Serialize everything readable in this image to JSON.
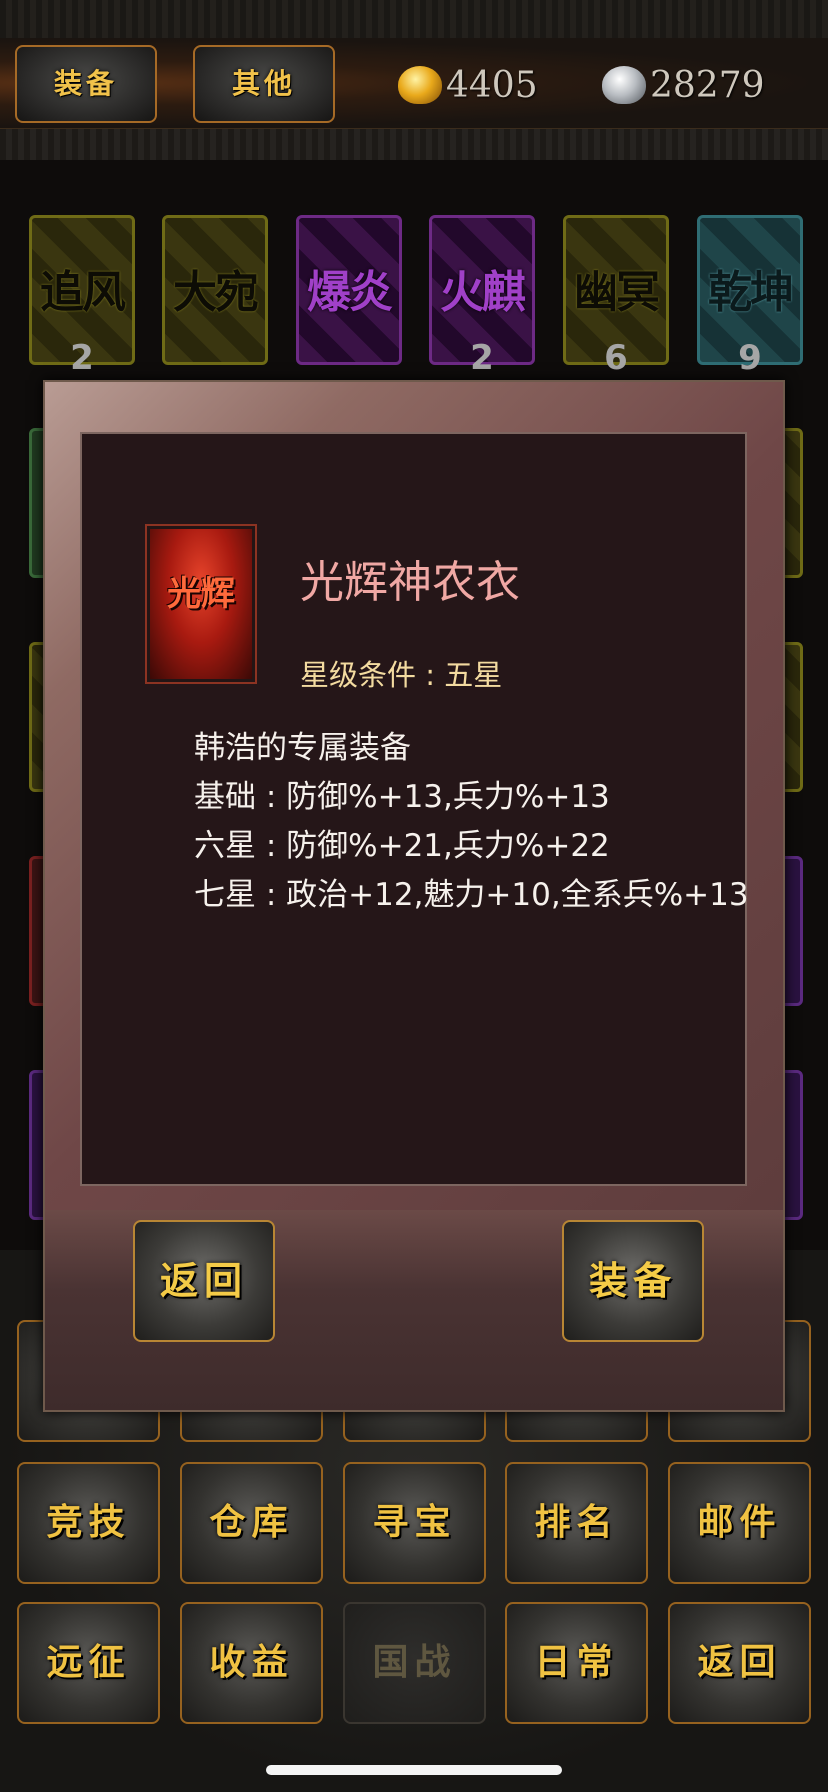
{
  "topbar": {
    "tab_equip": "装备",
    "tab_other": "其他",
    "gold": {
      "icon": "gold-ingot-icon",
      "amount": "4405"
    },
    "silver": {
      "icon": "silver-ingot-icon",
      "amount": "28279"
    }
  },
  "horses": [
    {
      "name": "追风",
      "count": "2",
      "quality": "yellow"
    },
    {
      "name": "大宛",
      "count": "",
      "quality": "yellow"
    },
    {
      "name": "爆炎",
      "count": "",
      "quality": "purple"
    },
    {
      "name": "火麒",
      "count": "2",
      "quality": "purple"
    },
    {
      "name": "幽冥",
      "count": "6",
      "quality": "yellow"
    },
    {
      "name": "乾坤",
      "count": "9",
      "quality": "teal"
    }
  ],
  "popup": {
    "item_icon_text": "光辉",
    "item_name": "光辉神农衣",
    "star_condition": "星级条件 : 五星",
    "desc": [
      "韩浩的专属装备",
      "基础 : 防御%+13,兵力%+13",
      "六星 : 防御%+21,兵力%+22",
      "七星 : 政治+12,魅力+10,全系兵%+13"
    ],
    "back_button": "返回",
    "equip_button": "装备"
  },
  "menu": {
    "row2": [
      "竞技",
      "仓库",
      "寻宝",
      "排名",
      "邮件"
    ],
    "row3": [
      "远征",
      "收益",
      "国战",
      "日常",
      "返回"
    ]
  },
  "colors": {
    "gold_text": "#f0c242",
    "item_name": "#f0a8a4",
    "star_condition": "#f3dba0"
  }
}
